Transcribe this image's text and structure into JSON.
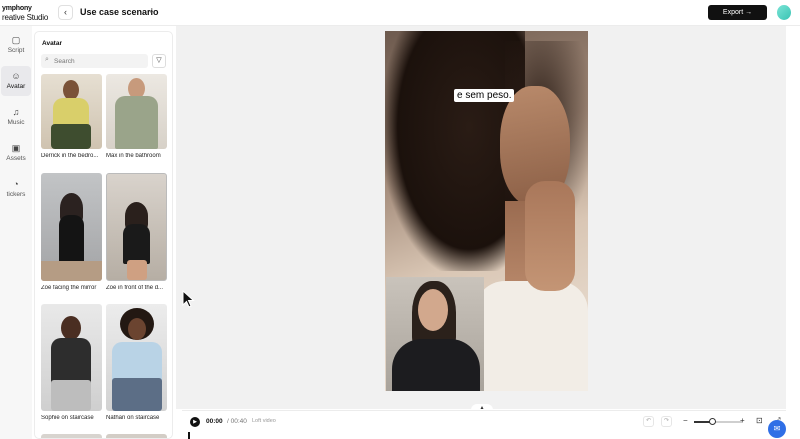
{
  "app": {
    "brand_line1": "ymphony",
    "brand_line2": "reative Studio",
    "project_title": "Use case scenario",
    "export_label": "Export →"
  },
  "icons": {
    "back": "chevron-left-icon",
    "caret": "chevron-down-icon",
    "search": "search-icon",
    "filter": "filter-icon",
    "play": "play-icon",
    "zoom_out": "minus-icon",
    "zoom_in": "plus-icon",
    "chat": "chat-icon"
  },
  "rail": [
    {
      "label": "Script",
      "icon": "script-icon"
    },
    {
      "label": "Avatar",
      "icon": "avatar-icon"
    },
    {
      "label": "Music",
      "icon": "music-icon"
    },
    {
      "label": "Assets",
      "icon": "assets-icon"
    },
    {
      "label": "tickers",
      "icon": "stickers-icon"
    }
  ],
  "panel": {
    "title": "Avatar",
    "search_placeholder": "Search",
    "avatars": [
      {
        "name": "Derrick in the bedro..."
      },
      {
        "name": "Max in the bathroom"
      },
      {
        "name": "Zoe facing the mirror"
      },
      {
        "name": "Zoe in front of the d..."
      },
      {
        "name": "Sophie on staircase"
      },
      {
        "name": "Nathan on staircase"
      }
    ]
  },
  "preview": {
    "caption": "e sem peso."
  },
  "timeline": {
    "current_time": "00:00",
    "total_time": "/ 00:40",
    "info": "Loft video",
    "zoom_level": 0.4
  },
  "colors": {
    "accent": "#2f6fe6",
    "export_bg": "#111111",
    "profile": "#39c3b3"
  }
}
